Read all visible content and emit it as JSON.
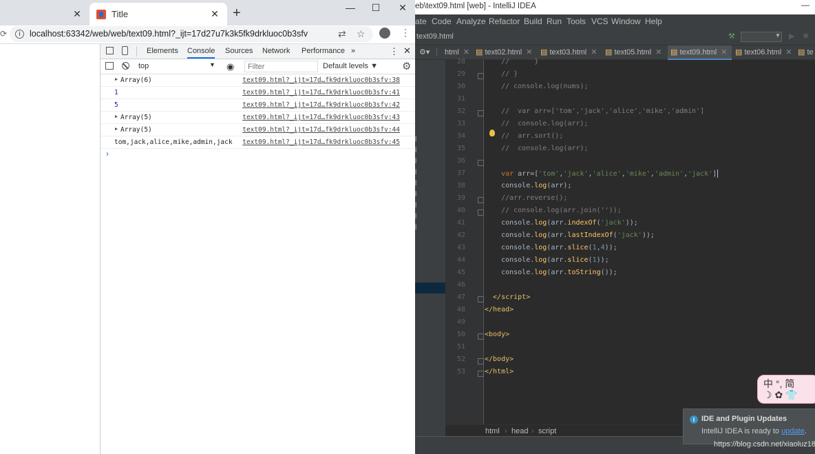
{
  "chrome": {
    "tab_left_title": "",
    "tab_title": "Title",
    "url": "localhost:63342/web/web/text09.html?_ijt=17d27u7k3k5fk9drkluoc0b3sfv",
    "new_tab": "+",
    "close": "✕",
    "minimize": "—",
    "maximize": "☐"
  },
  "devtools": {
    "tabs": [
      "Elements",
      "Console",
      "Sources",
      "Network",
      "Performance",
      "»"
    ],
    "context": "top",
    "filter_placeholder": "Filter",
    "levels": "Default levels ▼",
    "logs": [
      {
        "text": "Array(6)",
        "type": "array",
        "src": "text09.html?_ijt=17d…fk9drkluoc0b3sfv:38"
      },
      {
        "text": "1",
        "type": "number",
        "src": "text09.html?_ijt=17d…fk9drkluoc0b3sfv:41"
      },
      {
        "text": "5",
        "type": "number",
        "src": "text09.html?_ijt=17d…fk9drkluoc0b3sfv:42"
      },
      {
        "text": "Array(5)",
        "type": "array",
        "src": "text09.html?_ijt=17d…fk9drkluoc0b3sfv:43"
      },
      {
        "text": "Array(5)",
        "type": "array",
        "src": "text09.html?_ijt=17d…fk9drkluoc0b3sfv:44"
      },
      {
        "text": "tom,jack,alice,mike,admin,jack",
        "type": "string",
        "src": "text09.html?_ijt=17d…fk9drkluoc0b3sfv:45"
      }
    ],
    "prompt": "›"
  },
  "idea": {
    "title": "eb\\text09.html [web] - IntelliJ IDEA",
    "menu": [
      "ate",
      "Code",
      "Analyze",
      "Refactor",
      "Build",
      "Run",
      "Tools",
      "VCS",
      "Window",
      "Help"
    ],
    "nav_file": "text09.html",
    "tabs": [
      "html",
      "text02.html",
      "text03.html",
      "text05.html",
      "text09.html",
      "text06.html",
      "te"
    ],
    "active_tab": "text09.html",
    "line_numbers": [
      "28",
      "29",
      "30",
      "31",
      "32",
      "33",
      "34",
      "35",
      "36",
      "37",
      "38",
      "39",
      "40",
      "41",
      "42",
      "43",
      "44",
      "45",
      "46",
      "47",
      "48",
      "49",
      "50",
      "51",
      "52",
      "53"
    ],
    "breadcrumb": [
      "html",
      "head",
      "script"
    ],
    "popup_title": "IDE and Plugin Updates",
    "popup_body": "IntelliJ IDEA is ready to",
    "popup_link": "update",
    "ime_text": "中 °, 简",
    "ime_text2": "☽ ✿ 👕",
    "watermark": "https://blog.csdn.net/xiaoluz18"
  }
}
